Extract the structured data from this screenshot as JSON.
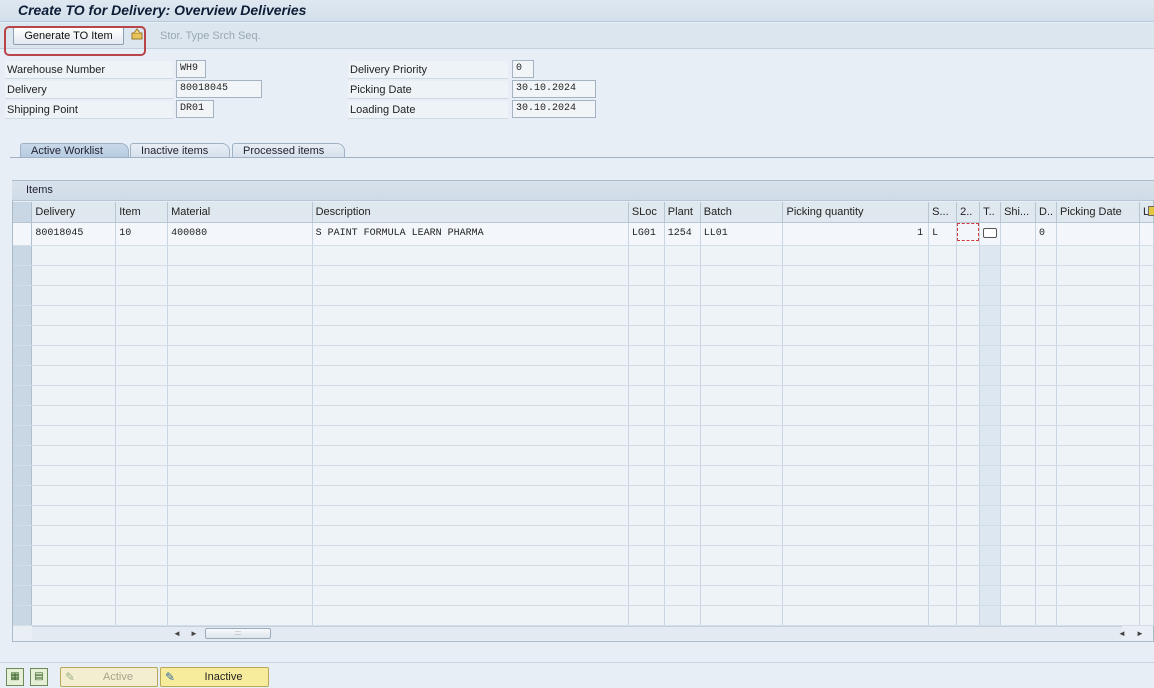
{
  "window": {
    "title": "Create TO for Delivery: Overview Deliveries"
  },
  "toolbar": {
    "generate_label": "Generate TO Item",
    "stor_type_label": "Stor. Type Srch Seq."
  },
  "header_fields": {
    "warehouse_number": {
      "label": "Warehouse Number",
      "value": "WH9"
    },
    "delivery": {
      "label": "Delivery",
      "value": "80018045"
    },
    "shipping_point": {
      "label": "Shipping Point",
      "value": "DR01"
    },
    "delivery_priority": {
      "label": "Delivery Priority",
      "value": "0"
    },
    "picking_date": {
      "label": "Picking Date",
      "value": "30.10.2024"
    },
    "loading_date": {
      "label": "Loading Date",
      "value": "30.10.2024"
    }
  },
  "tabs": [
    {
      "label": "Active Worklist",
      "active": true
    },
    {
      "label": "Inactive items",
      "active": false
    },
    {
      "label": "Processed items",
      "active": false
    }
  ],
  "items": {
    "title": "Items",
    "columns": [
      "Delivery",
      "Item",
      "Material",
      "Description",
      "SLoc",
      "Plant",
      "Batch",
      "Picking quantity",
      "S...",
      "2..",
      "T..",
      "Shi...",
      "D..",
      "Picking Date",
      "L"
    ],
    "rows": [
      {
        "delivery": "80018045",
        "item": "10",
        "material": "400080",
        "description": "S PAINT FORMULA LEARN PHARMA",
        "sloc": "LG01",
        "plant": "1254",
        "batch": "LL01",
        "picking_quantity": "1",
        "s": "L",
        "d": "0"
      }
    ]
  },
  "bottom": {
    "active_label": "Active",
    "inactive_label": "Inactive"
  },
  "colors": {
    "highlight_border": "#b7454a",
    "inactive_button": "#f7ec9c",
    "active_button": "#f4eed0"
  }
}
